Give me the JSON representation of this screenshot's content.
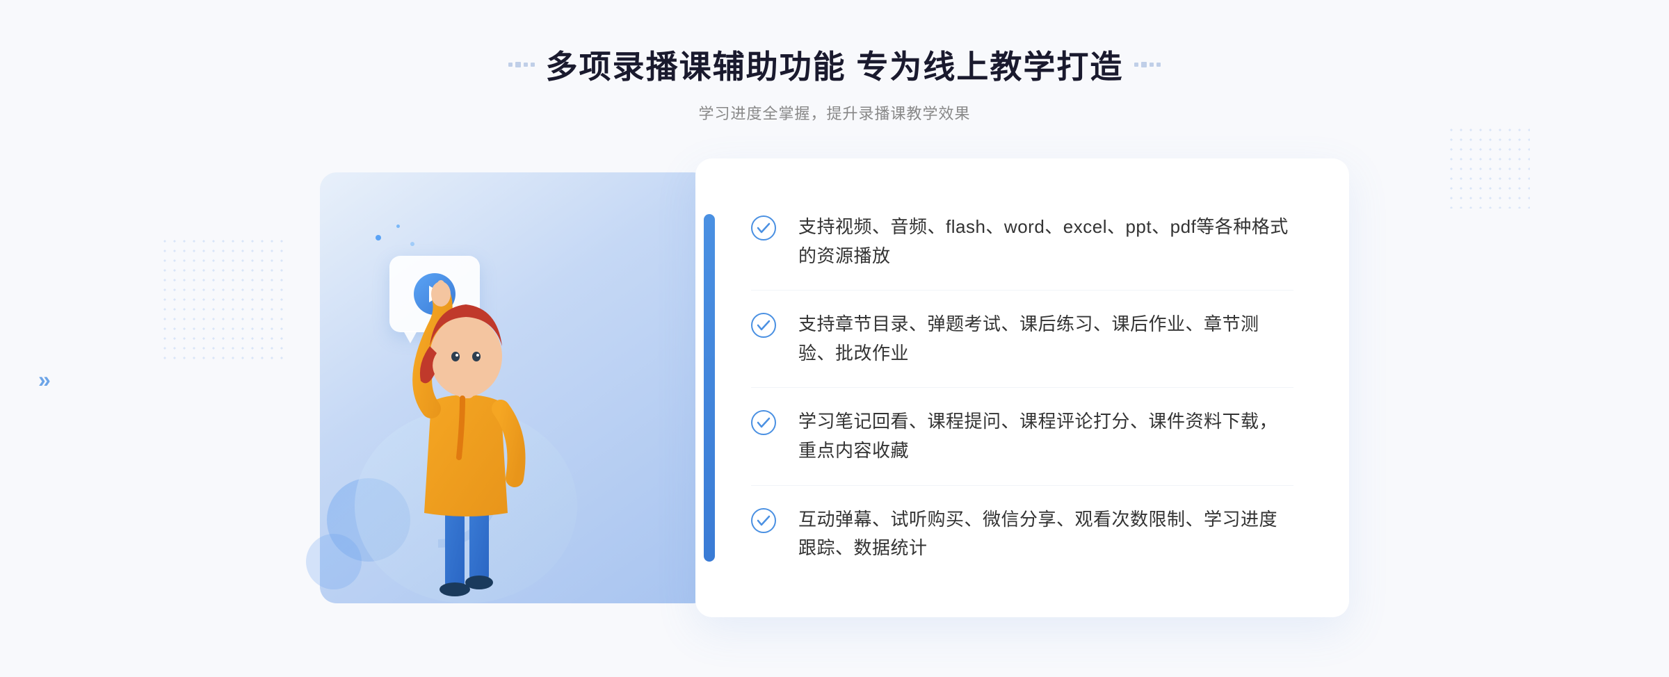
{
  "header": {
    "title": "多项录播课辅助功能 专为线上教学打造",
    "subtitle": "学习进度全掌握，提升录播课教学效果",
    "decorator_left": "❋",
    "decorator_right": "❋"
  },
  "features": [
    {
      "id": 1,
      "text": "支持视频、音频、flash、word、excel、ppt、pdf等各种格式的资源播放"
    },
    {
      "id": 2,
      "text": "支持章节目录、弹题考试、课后练习、课后作业、章节测验、批改作业"
    },
    {
      "id": 3,
      "text": "学习笔记回看、课程提问、课程评论打分、课件资料下载，重点内容收藏"
    },
    {
      "id": 4,
      "text": "互动弹幕、试听购买、微信分享、观看次数限制、学习进度跟踪、数据统计"
    }
  ],
  "colors": {
    "primary": "#4a90e2",
    "title": "#1a1a2e",
    "subtitle": "#888888",
    "text": "#333333",
    "check": "#4a90e2",
    "bg": "#f8f9fc"
  },
  "icons": {
    "play": "▶",
    "check": "✓",
    "chevron_left": "»"
  }
}
